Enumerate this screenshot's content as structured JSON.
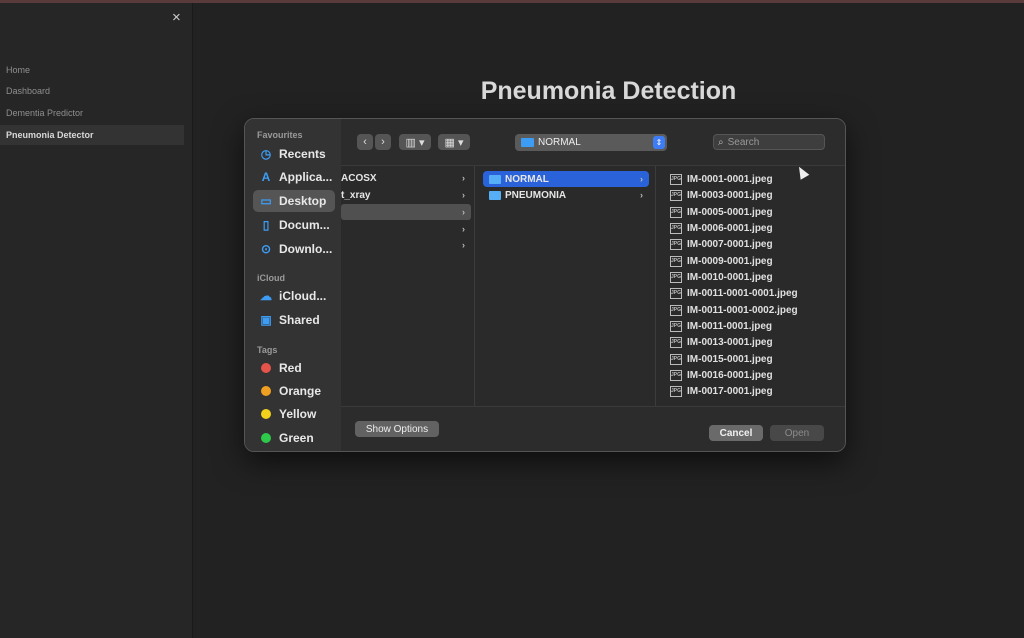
{
  "sidebar": {
    "close_label": "×",
    "items": [
      {
        "label": "Home"
      },
      {
        "label": "Dashboard"
      },
      {
        "label": "Dementia Predictor"
      },
      {
        "label": "Pneumonia Detector"
      }
    ]
  },
  "page": {
    "title": "Pneumonia Detection"
  },
  "dialog": {
    "favourites_label": "Favourites",
    "favourites": [
      {
        "label": "Recents",
        "icon": "clock-icon"
      },
      {
        "label": "Applica...",
        "icon": "applications-icon"
      },
      {
        "label": "Desktop",
        "icon": "desktop-icon"
      },
      {
        "label": "Docum...",
        "icon": "document-icon"
      },
      {
        "label": "Downlo...",
        "icon": "download-icon"
      }
    ],
    "icloud_label": "iCloud",
    "icloud": [
      {
        "label": "iCloud...",
        "icon": "cloud-icon"
      },
      {
        "label": "Shared",
        "icon": "shared-folder-icon"
      }
    ],
    "tags_label": "Tags",
    "tags": [
      {
        "label": "Red",
        "color": "#e5534b"
      },
      {
        "label": "Orange",
        "color": "#f0a020"
      },
      {
        "label": "Yellow",
        "color": "#f2d21b"
      },
      {
        "label": "Green",
        "color": "#2ec84a"
      }
    ],
    "toolbar": {
      "back": "‹",
      "forward": "›",
      "current_folder": "NORMAL",
      "search_placeholder": "Search"
    },
    "column1": [
      {
        "label": "ACOSX"
      },
      {
        "label": "t_xray"
      },
      {
        "label": ""
      },
      {
        "label": ""
      },
      {
        "label": ""
      }
    ],
    "column2": [
      {
        "label": "NORMAL",
        "selected": true
      },
      {
        "label": "PNEUMONIA",
        "selected": false
      }
    ],
    "files": [
      "IM-0001-0001.jpeg",
      "IM-0003-0001.jpeg",
      "IM-0005-0001.jpeg",
      "IM-0006-0001.jpeg",
      "IM-0007-0001.jpeg",
      "IM-0009-0001.jpeg",
      "IM-0010-0001.jpeg",
      "IM-0011-0001-0001.jpeg",
      "IM-0011-0001-0002.jpeg",
      "IM-0011-0001.jpeg",
      "IM-0013-0001.jpeg",
      "IM-0015-0001.jpeg",
      "IM-0016-0001.jpeg",
      "IM-0017-0001.jpeg"
    ],
    "buttons": {
      "show_options": "Show Options",
      "cancel": "Cancel",
      "open": "Open"
    }
  }
}
